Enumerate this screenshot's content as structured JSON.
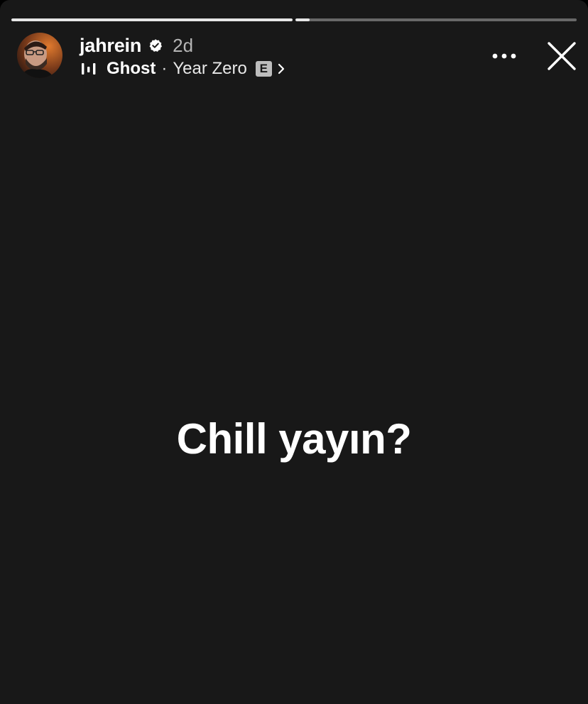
{
  "story": {
    "progress": [
      1.0,
      0.05
    ],
    "user": {
      "username": "jahrein",
      "posted_ago": "2d",
      "verified": true,
      "avatar_icon": "profile-photo"
    },
    "music": {
      "song": "Ghost",
      "separator": "·",
      "artist": "Year Zero",
      "explicit_badge": "E"
    },
    "caption": "Chill yayın?",
    "icons": {
      "more": "more-horizontal-icon",
      "close": "close-icon",
      "music": "music-bars-icon",
      "verified": "verified-badge-icon",
      "chevron": "chevron-right-icon"
    },
    "colors": {
      "background": "#181818",
      "text": "#ffffff",
      "muted": "#b5b5b5"
    }
  }
}
